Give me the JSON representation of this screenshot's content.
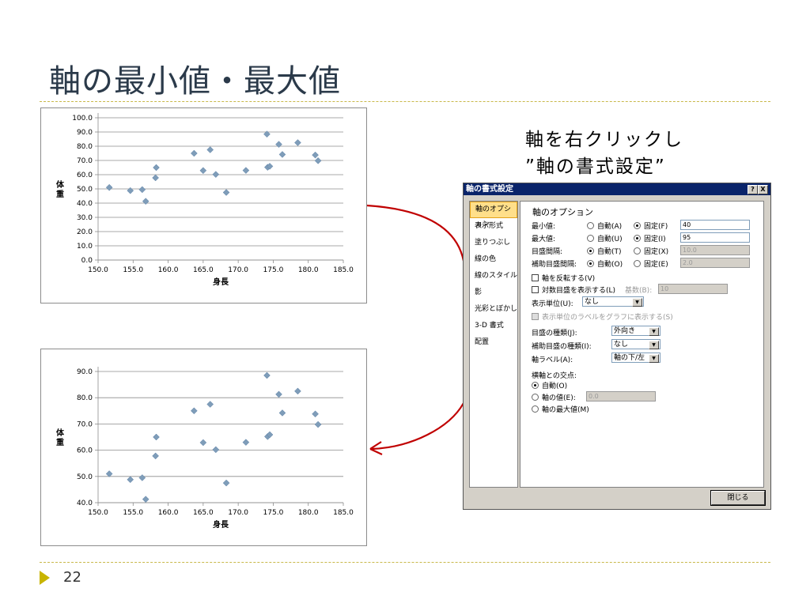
{
  "slide": {
    "title": "軸の最小値・最大値",
    "callout_line1": "軸を右クリックし",
    "callout_line2": "”軸の書式設定”",
    "page_number": "22"
  },
  "colors": {
    "marker": "#7f9db9",
    "arrow": "#c00000",
    "accent_line": "#c8b84a",
    "title": "#2b3a4a"
  },
  "chart_data": [
    {
      "type": "scatter",
      "title": "",
      "xlabel": "身長",
      "ylabel": "体重",
      "xlim": [
        150.0,
        185.0
      ],
      "ylim": [
        0.0,
        100.0
      ],
      "xticks": [
        "150.0",
        "155.0",
        "160.0",
        "165.0",
        "170.0",
        "175.0",
        "180.0",
        "185.0"
      ],
      "yticks": [
        "0.0",
        "10.0",
        "20.0",
        "30.0",
        "40.0",
        "50.0",
        "60.0",
        "70.0",
        "80.0",
        "90.0",
        "100.0"
      ],
      "grid": true,
      "x": [
        151.6,
        154.6,
        156.3,
        156.8,
        158.2,
        158.3,
        163.7,
        165.0,
        166.0,
        166.8,
        168.3,
        171.1,
        174.1,
        174.2,
        174.5,
        175.8,
        176.3,
        178.5,
        181.0,
        181.4
      ],
      "y": [
        51.0,
        48.8,
        49.5,
        41.3,
        57.8,
        65.0,
        75.0,
        62.9,
        77.5,
        60.2,
        47.5,
        63.0,
        88.5,
        65.2,
        65.9,
        81.3,
        74.2,
        82.5,
        73.8,
        69.8
      ]
    },
    {
      "type": "scatter",
      "title": "",
      "xlabel": "身長",
      "ylabel": "体重",
      "xlim": [
        150.0,
        185.0
      ],
      "ylim": [
        40.0,
        90.0
      ],
      "xticks": [
        "150.0",
        "155.0",
        "160.0",
        "165.0",
        "170.0",
        "175.0",
        "180.0",
        "185.0"
      ],
      "yticks": [
        "40.0",
        "50.0",
        "60.0",
        "70.0",
        "80.0",
        "90.0"
      ],
      "grid": true,
      "x": [
        151.6,
        154.6,
        156.3,
        156.8,
        158.2,
        158.3,
        163.7,
        165.0,
        166.0,
        166.8,
        168.3,
        171.1,
        174.1,
        174.2,
        174.5,
        175.8,
        176.3,
        178.5,
        181.0,
        181.4
      ],
      "y": [
        51.0,
        48.8,
        49.5,
        41.3,
        57.8,
        65.0,
        75.0,
        62.9,
        77.5,
        60.2,
        47.5,
        63.0,
        88.5,
        65.2,
        65.9,
        81.3,
        74.2,
        82.5,
        73.8,
        69.8
      ]
    }
  ],
  "dialog": {
    "title": "軸の書式設定",
    "help_button": "?",
    "close_x": "X",
    "sidebar": [
      "軸のオプション",
      "表示形式",
      "塗りつぶし",
      "線の色",
      "線のスタイル",
      "影",
      "光彩とぼかし",
      "3-D 書式",
      "配置"
    ],
    "section_title": "軸のオプション",
    "min_label": "最小値:",
    "max_label": "最大値:",
    "major_label": "目盛間隔:",
    "minor_label": "補助目盛間隔:",
    "auto_a": "自動(A)",
    "fixed_f": "固定(F)",
    "auto_u": "自動(U)",
    "fixed_i": "固定(I)",
    "auto_t": "自動(T)",
    "fixed_x": "固定(X)",
    "auto_o": "自動(O)",
    "fixed_e": "固定(E)",
    "min_value": "40",
    "max_value": "95",
    "major_value": "10.0",
    "minor_value": "2.0",
    "reverse_label": "軸を反転する(V)",
    "log_label": "対数目盛を表示する(L)",
    "base_label": "基数(B):",
    "base_value": "10",
    "display_units_label": "表示単位(U):",
    "display_units_value": "なし",
    "show_units_label": "表示単位のラベルをグラフに表示する(S)",
    "major_tick_label": "目盛の種類(J):",
    "major_tick_value": "外向き",
    "minor_tick_label": "補助目盛の種類(I):",
    "minor_tick_value": "なし",
    "axis_labels_label": "軸ラベル(A):",
    "axis_labels_value": "軸の下/左",
    "cross_title": "横軸との交点:",
    "cross_auto": "自動(O)",
    "cross_value_label": "軸の値(E):",
    "cross_value": "0.0",
    "cross_max": "軸の最大値(M)",
    "close_button": "閉じる"
  }
}
